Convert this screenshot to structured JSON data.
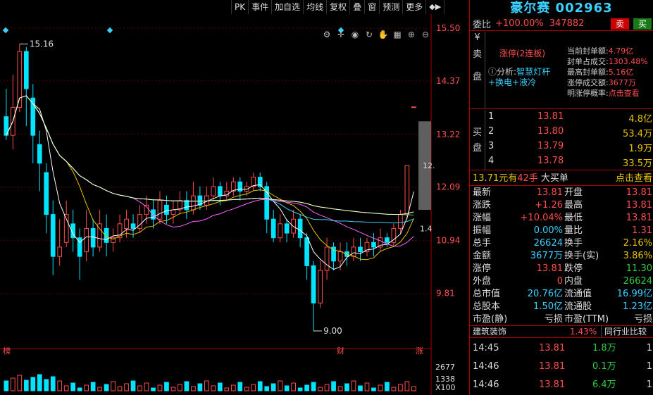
{
  "toolbar": {
    "items": [
      "PK",
      "事件",
      "加自选",
      "均线",
      "复权",
      "叠",
      "窗",
      "预测",
      "更多"
    ],
    "arrow_label": "◆▶"
  },
  "chart": {
    "price_labels": [
      "15.50",
      "14.37",
      "13.22",
      "12.09",
      "10.94",
      "9.81"
    ],
    "high_label": "15.16",
    "low_label": "9.00",
    "current_label": "12.",
    "current_label2": "1.4",
    "bottom_markers": [
      "榜",
      "财",
      "涨"
    ],
    "volume_labels": [
      "2677",
      "1338",
      "X100"
    ]
  },
  "chart_data": {
    "type": "candlestick",
    "price_range": [
      9.0,
      15.5
    ],
    "high": 15.16,
    "low": 9.0,
    "last": 13.81
  },
  "stock": {
    "title": "豪尔赛 002963",
    "webi_label": "委比",
    "webi_pct": "+100.00%",
    "webi_diff": "347882",
    "sell_btn": "卖",
    "buy_btn": "买"
  },
  "sell": {
    "side_label": [
      "¥",
      "卖",
      "盘"
    ],
    "status": "涨停(2连板)",
    "analysis_prefix": "分析:",
    "analysis_text": "智慧灯杆+换电+液冷",
    "seal": [
      {
        "k": "当前封单额:",
        "v": "4.79亿"
      },
      {
        "k": "封单占成交:",
        "v": "1303.48%"
      },
      {
        "k": "最高封单额:",
        "v": "5.16亿"
      },
      {
        "k": "涨停成交额:",
        "v": "3677万"
      },
      {
        "k": "明涨停概率:",
        "v": "点击查看"
      }
    ]
  },
  "buy": {
    "side_label": [
      "买",
      "盘"
    ],
    "rows": [
      {
        "lv": "1",
        "pr": "13.81",
        "vol": "4.8亿"
      },
      {
        "lv": "2",
        "pr": "13.80",
        "vol": "53.4万"
      },
      {
        "lv": "3",
        "pr": "13.79",
        "vol": "1.9万"
      },
      {
        "lv": "4",
        "pr": "13.78",
        "vol": "33.5万"
      }
    ]
  },
  "trade": {
    "a": "13.71元有",
    "b": "42手",
    "c": "大买单",
    "d": "点击查看"
  },
  "quote": [
    {
      "k1": "最新",
      "v1": "13.81",
      "c1": "red",
      "k2": "开盘",
      "v2": "13.81",
      "c2": "red"
    },
    {
      "k1": "涨跌",
      "v1": "+1.26",
      "c1": "red",
      "k2": "最高",
      "v2": "13.81",
      "c2": "red"
    },
    {
      "k1": "涨幅",
      "v1": "+10.04%",
      "c1": "red",
      "k2": "最低",
      "v2": "13.81",
      "c2": "red"
    },
    {
      "k1": "振幅",
      "v1": "0.00%",
      "c1": "cyan",
      "k2": "量比",
      "v2": "1.31",
      "c2": "red"
    },
    {
      "k1": "总手",
      "v1": "26624",
      "c1": "cyan",
      "k2": "换手",
      "v2": "2.16%",
      "c2": "yellow"
    },
    {
      "k1": "金额",
      "v1": "3677万",
      "c1": "cyan",
      "k2": "换手(实)",
      "v2": "3.86%",
      "c2": "yellow"
    },
    {
      "k1": "涨停",
      "v1": "13.81",
      "c1": "red",
      "k2": "跌停",
      "v2": "11.30",
      "c2": "green"
    },
    {
      "k1": "外盘",
      "v1": "0",
      "c1": "red",
      "k2": "内盘",
      "v2": "26624",
      "c2": "green"
    },
    {
      "k1": "总市值",
      "v1": "20.76亿",
      "c1": "cyan",
      "k2": "流通值",
      "v2": "16.99亿",
      "c2": "cyan"
    },
    {
      "k1": "总股本",
      "v1": "1.50亿",
      "c1": "cyan",
      "k2": "流通股",
      "v2": "1.23亿",
      "c2": "cyan"
    },
    {
      "k1": "市盈(静)",
      "v1": "亏损",
      "c1": "white",
      "k2": "市盈(TTM)",
      "v2": "亏损",
      "c2": "white"
    }
  ],
  "sector": {
    "name": "建筑装饰",
    "pct": "1.43%",
    "label": "同行业比较"
  },
  "ticks": [
    {
      "t": "14:45",
      "p": "13.81",
      "v": "1.8万",
      "f": "1"
    },
    {
      "t": "14:46",
      "p": "13.81",
      "v": "0.1万",
      "f": "1"
    },
    {
      "t": "14:46",
      "p": "13.81",
      "v": "6.4万",
      "f": "1"
    }
  ],
  "colors": {
    "up": "#ff4d4d",
    "down": "#00e5ff",
    "ma5": "#ffffff",
    "ma10": "#e6c200",
    "ma20": "#ff66ff",
    "ma60": "#2ecc40"
  }
}
